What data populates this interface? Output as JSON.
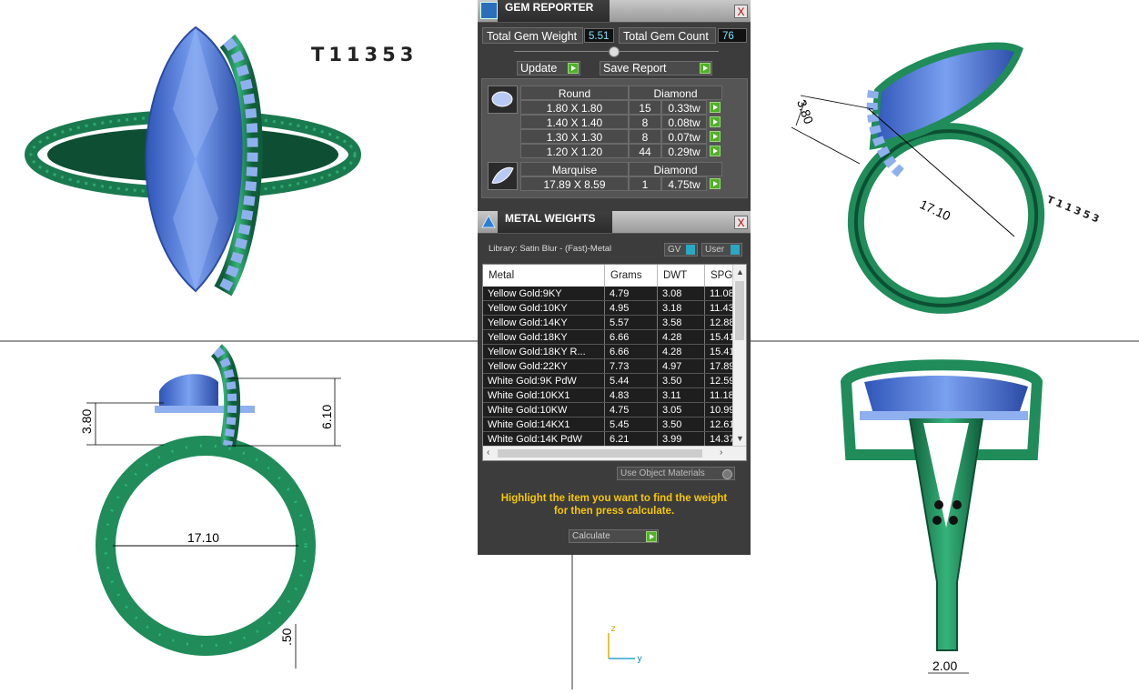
{
  "viewport": {
    "ring_label_top": "T11353",
    "ring_label_persp": "T11353",
    "dims": {
      "tr_height": "3.80",
      "tr_width": "17.10",
      "bl_height1": "3.80",
      "bl_height2": "6.10",
      "bl_width": "17.10",
      "bl_shank": ".50",
      "br_shank": "2.00"
    },
    "axis": {
      "z": "z",
      "y": "y"
    },
    "colors": {
      "metal": "#1f8c5a",
      "gem": "#3b63c4",
      "bg": "#ffffff"
    }
  },
  "gem_reporter": {
    "title": "GEM REPORTER",
    "close": "X",
    "total_weight_label": "Total Gem Weight",
    "total_weight_value": "5.51",
    "total_count_label": "Total Gem Count",
    "total_count_value": "76",
    "update_label": "Update",
    "save_report_label": "Save Report",
    "groups": [
      {
        "shape": "Round",
        "material": "Diamond",
        "icon": "round-gem-icon",
        "rows": [
          {
            "size": "1.80 X 1.80",
            "count": "15",
            "weight": "0.33tw"
          },
          {
            "size": "1.40 X 1.40",
            "count": "8",
            "weight": "0.08tw"
          },
          {
            "size": "1.30 X 1.30",
            "count": "8",
            "weight": "0.07tw"
          },
          {
            "size": "1.20 X 1.20",
            "count": "44",
            "weight": "0.29tw"
          }
        ]
      },
      {
        "shape": "Marquise",
        "material": "Diamond",
        "icon": "marquise-gem-icon",
        "rows": [
          {
            "size": "17.89 X 8.59",
            "count": "1",
            "weight": "4.75tw"
          }
        ]
      }
    ]
  },
  "metal_weights": {
    "title": "METAL WEIGHTS",
    "close": "X",
    "library_label": "Library: Satin Blur - (Fast)-Metal",
    "gv_label": "GV",
    "user_label": "User",
    "columns": [
      "Metal",
      "Grams",
      "DWT",
      "SPG"
    ],
    "rows": [
      [
        "Yellow Gold:9KY",
        "4.79",
        "3.08",
        "11.08"
      ],
      [
        "Yellow Gold:10KY",
        "4.95",
        "3.18",
        "11.43"
      ],
      [
        "Yellow Gold:14KY",
        "5.57",
        "3.58",
        "12.88"
      ],
      [
        "Yellow Gold:18KY",
        "6.66",
        "4.28",
        "15.41"
      ],
      [
        "Yellow Gold:18KY R...",
        "6.66",
        "4.28",
        "15.41"
      ],
      [
        "Yellow Gold:22KY",
        "7.73",
        "4.97",
        "17.89"
      ],
      [
        "White Gold:9K PdW",
        "5.44",
        "3.50",
        "12.59"
      ],
      [
        "White Gold:10KX1",
        "4.83",
        "3.11",
        "11.18"
      ],
      [
        "White Gold:10KW",
        "4.75",
        "3.05",
        "10.99"
      ],
      [
        "White Gold:14KX1",
        "5.45",
        "3.50",
        "12.61"
      ],
      [
        "White Gold:14K PdW",
        "6.21",
        "3.99",
        "14.37"
      ]
    ],
    "use_object_materials": "Use Object Materials",
    "hint": "Highlight the item you want to find the weight for then press calculate.",
    "calculate_label": "Calculate"
  }
}
